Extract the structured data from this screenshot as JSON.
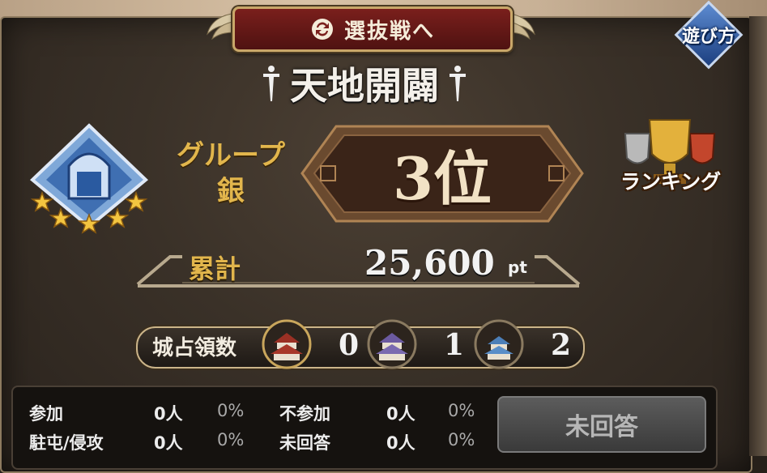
{
  "header": {
    "select_button_label": "選抜戦へ",
    "howto_label": "遊び方"
  },
  "title": "天地開闢",
  "group": {
    "label_line1": "グループ",
    "label_line2": "銀",
    "rank": "3位"
  },
  "ranking_label": "ランキング",
  "total": {
    "label": "累計",
    "value": "25,600",
    "unit": "pt"
  },
  "castles": {
    "label": "城占領数",
    "counts": [
      "0",
      "1",
      "2"
    ]
  },
  "stats": {
    "join_label": "参加",
    "join_count": "0人",
    "join_pct": "0%",
    "nojoin_label": "不参加",
    "nojoin_count": "0人",
    "nojoin_pct": "0%",
    "station_label": "駐屯/侵攻",
    "station_count": "0人",
    "station_pct": "0%",
    "unanswered_label": "未回答",
    "unanswered_count": "0人",
    "unanswered_pct": "0%"
  },
  "unanswered_button_label": "未回答",
  "colors": {
    "gold_text": "#e2b64c",
    "button_red": "#7a1f1c",
    "panel_brown": "#3a3128"
  }
}
